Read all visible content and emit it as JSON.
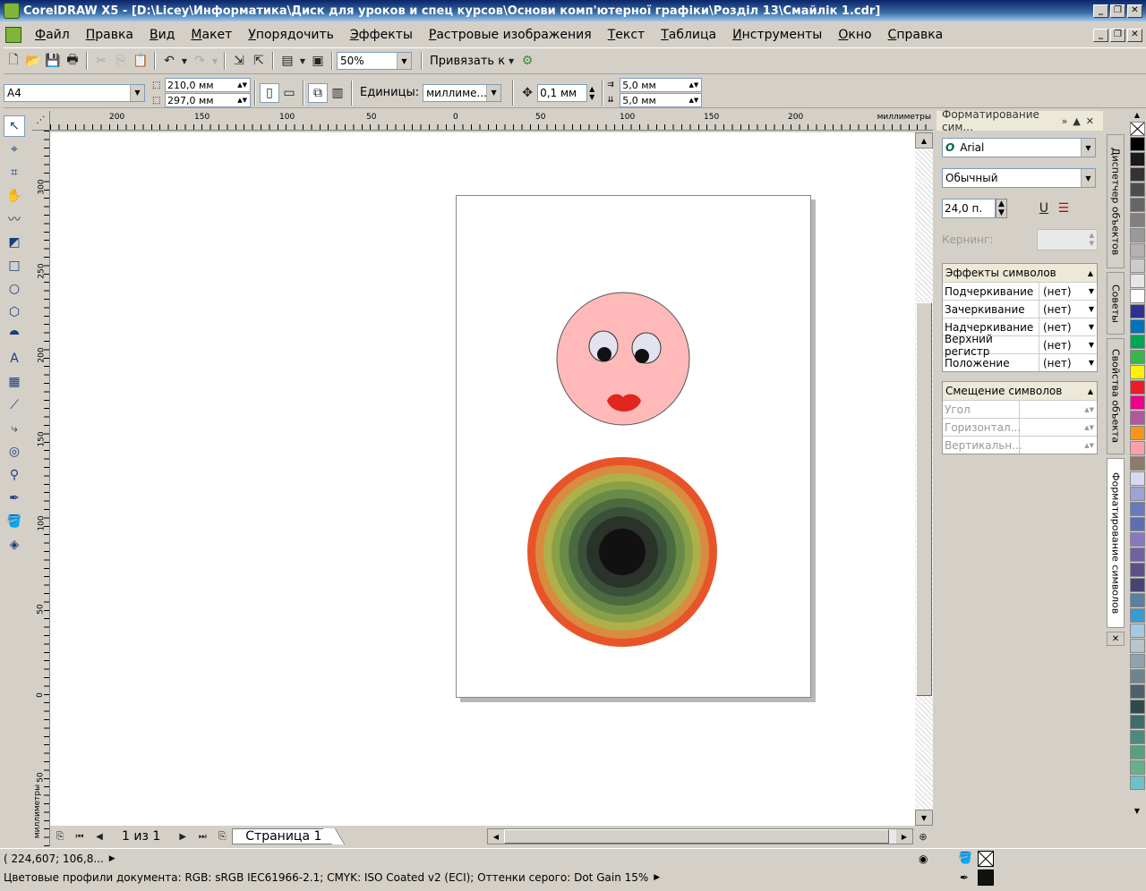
{
  "window": {
    "title": "CorelDRAW X5 - [D:\\Licey\\Информатика\\Диск для уроков и спец курсов\\Основи комп'ютерної графіки\\Розділ 13\\Смайлік 1.cdr]"
  },
  "menu": [
    "Файл",
    "Правка",
    "Вид",
    "Макет",
    "Упорядочить",
    "Эффекты",
    "Растровые изображения",
    "Текст",
    "Таблица",
    "Инструменты",
    "Окно",
    "Справка"
  ],
  "toolbar": {
    "zoom": "50%",
    "snap_label": "Привязать к"
  },
  "property_bar": {
    "page_size": "A4",
    "width": "210,0 мм",
    "height": "297,0 мм",
    "units_label": "Единицы:",
    "units_value": "миллиме...",
    "nudge": "0,1 мм",
    "dup_x": "5,0 мм",
    "dup_y": "5,0 мм"
  },
  "ruler": {
    "units": "миллиметры",
    "h_ticks": [
      "200",
      "150",
      "100",
      "50",
      "0",
      "50",
      "100",
      "150",
      "200"
    ],
    "v_ticks": [
      "300",
      "250",
      "200",
      "150",
      "100",
      "50",
      "0",
      "50"
    ],
    "v_units": "миллиметры"
  },
  "pages": {
    "counter": "1 из 1",
    "tab": "Страница 1"
  },
  "docker": {
    "title": "Форматирование сим...",
    "font": "Arial",
    "style": "Обычный",
    "size": "24,0 п.",
    "kerning_label": "Кернинг:",
    "effects_title": "Эффекты символов",
    "effects": [
      {
        "label": "Подчеркивание",
        "value": "(нет)"
      },
      {
        "label": "Зачеркивание",
        "value": "(нет)"
      },
      {
        "label": "Надчеркивание",
        "value": "(нет)"
      },
      {
        "label": "Верхний регистр",
        "value": "(нет)"
      },
      {
        "label": "Положение",
        "value": "(нет)"
      }
    ],
    "shift_title": "Смещение символов",
    "shift": [
      {
        "label": "Угол"
      },
      {
        "label": "Горизонтал..."
      },
      {
        "label": "Вертикальн..."
      }
    ]
  },
  "docker_tabs": [
    "Диспетчер объектов",
    "Советы",
    "Свойства объекта",
    "Форматирование символов"
  ],
  "palette": [
    "#ffffff",
    "#000000",
    "#1a1a1a",
    "#333333",
    "#4d4d4d",
    "#666666",
    "#808080",
    "#999999",
    "#b3b3b3",
    "#cccccc",
    "#e6e6e6",
    "#ffffff",
    "#2e3192",
    "#0072bc",
    "#00a651",
    "#39b54a",
    "#fff200",
    "#ed1c24",
    "#ec008c",
    "#b0589f",
    "#f7941d",
    "#f9a0a8",
    "#8c7a6b",
    "#d9d9f2",
    "#9ea3d6",
    "#6a78c0",
    "#5c6fb5",
    "#8878c3",
    "#7161a3",
    "#5e4f88",
    "#4a4470",
    "#5a7fa0",
    "#3a9bd2",
    "#a6c8e0",
    "#b8c4cc",
    "#8fa3ae",
    "#6e8590",
    "#4e6069",
    "#2f4a4a",
    "#3c6e6a",
    "#4b8b7a",
    "#5ba07d",
    "#66b08a",
    "#70c0c8"
  ],
  "status": {
    "coords": "( 224,607; 106,8...",
    "profiles": "Цветовые профили документа: RGB: sRGB IEC61966-2.1; CMYK: ISO Coated v2 (ECI); Оттенки серого: Dot Gain 15%"
  }
}
